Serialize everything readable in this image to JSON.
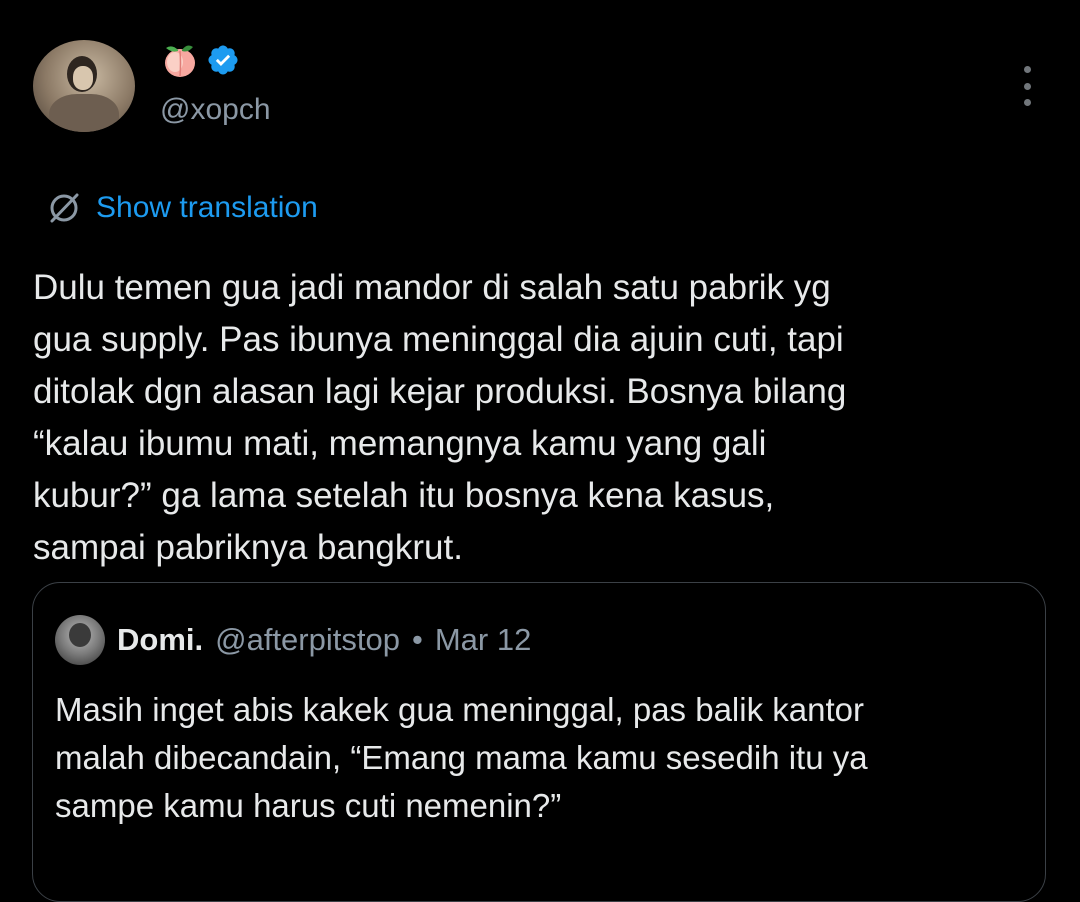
{
  "author": {
    "display_name_emoji": "🍑",
    "handle": "@xopch",
    "verified": true,
    "avatar_icon": "profile-photo",
    "verified_color": "#1d9bf0"
  },
  "translate": {
    "label": "Show translation",
    "icon": "globe-icon",
    "link_color": "#1d9bf0"
  },
  "tweet": {
    "text": "Dulu temen gua jadi mandor di salah satu pabrik yg\ngua supply. Pas ibunya meninggal dia ajuin cuti, tapi\nditolak dgn alasan lagi kejar produksi. Bosnya bilang\n“kalau ibumu mati, memangnya kamu yang gali\nkubur?” ga lama setelah itu bosnya kena kasus,\nsampai pabriknya bangkrut."
  },
  "quote": {
    "name": "Domi.",
    "handle": "@afterpitstop",
    "separator": "•",
    "date": "Mar 12",
    "text": "Masih inget abis kakek gua meninggal, pas balik kantor\nmalah dibecandain, “Emang mama kamu sesedih itu ya\nsampe kamu harus cuti nemenin?”"
  },
  "colors": {
    "background": "#000000",
    "text": "#e7e9ea",
    "muted": "#8b98a5",
    "accent": "#1d9bf0"
  }
}
